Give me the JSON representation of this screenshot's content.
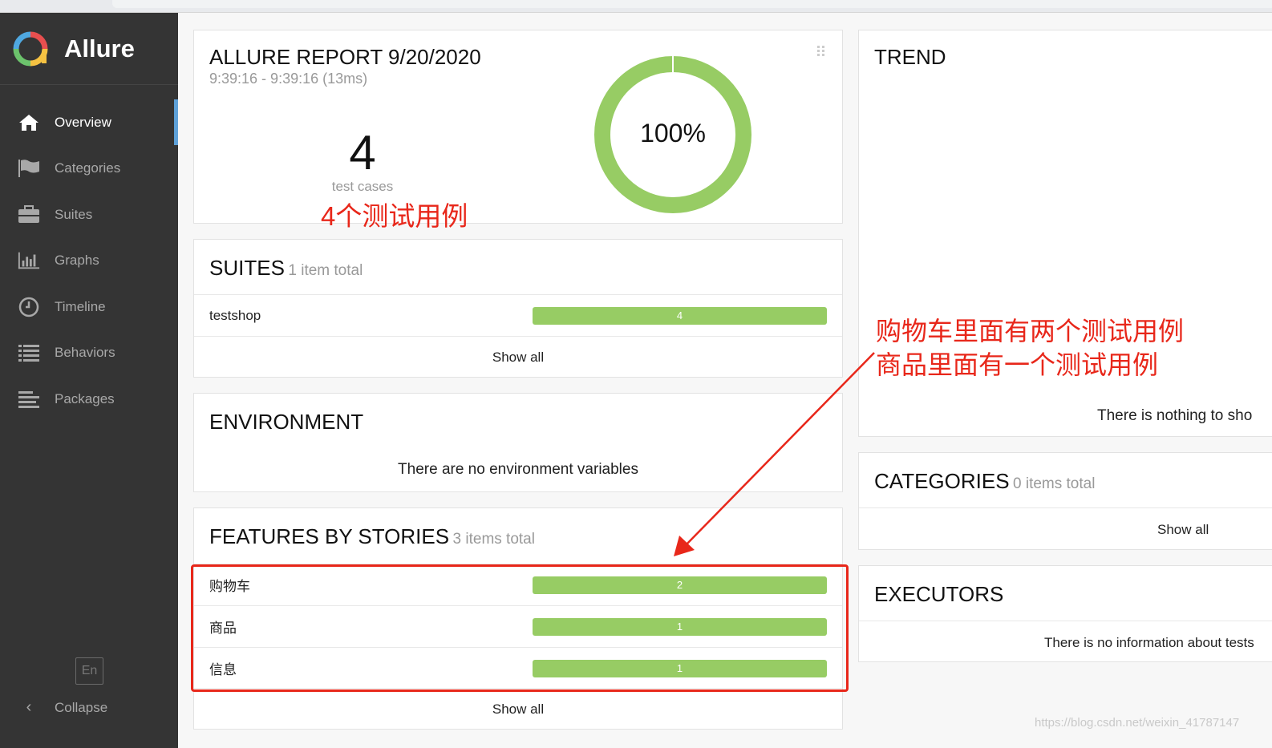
{
  "brand": {
    "name": "Allure"
  },
  "sidebar": {
    "items": [
      {
        "label": "Overview",
        "icon": "home-icon",
        "active": true
      },
      {
        "label": "Categories",
        "icon": "flag-icon"
      },
      {
        "label": "Suites",
        "icon": "briefcase-icon"
      },
      {
        "label": "Graphs",
        "icon": "bar-chart-icon"
      },
      {
        "label": "Timeline",
        "icon": "clock-icon"
      },
      {
        "label": "Behaviors",
        "icon": "list-icon"
      },
      {
        "label": "Packages",
        "icon": "align-left-icon"
      }
    ],
    "language": "En",
    "collapse_label": "Collapse"
  },
  "summary": {
    "title": "ALLURE REPORT 9/20/2020",
    "time": "9:39:16 - 9:39:16 (13ms)",
    "count": "4",
    "count_label": "test cases",
    "success_rate": "100%",
    "success_fraction": 1.0,
    "annotation": "4个测试用例"
  },
  "suites": {
    "title": "SUITES",
    "subtitle": "1 item total",
    "rows": [
      {
        "name": "testshop",
        "value": "4"
      }
    ],
    "show_all": "Show all"
  },
  "environment": {
    "title": "ENVIRONMENT",
    "empty_text": "There are no environment variables"
  },
  "features": {
    "title": "FEATURES BY STORIES",
    "subtitle": "3 items total",
    "rows": [
      {
        "name": "购物车",
        "value": "2"
      },
      {
        "name": "商品",
        "value": "1"
      },
      {
        "name": "信息",
        "value": "1"
      }
    ],
    "show_all": "Show all"
  },
  "trend": {
    "title": "TREND",
    "empty_text": "There is nothing to sho"
  },
  "categories": {
    "title": "CATEGORIES",
    "subtitle": "0 items total",
    "show_all": "Show all"
  },
  "executors": {
    "title": "EXECUTORS",
    "empty_text": "There is no information about tests"
  },
  "annotations": {
    "line1": "购物车里面有两个测试用例",
    "line2": "商品里面有一个测试用例"
  },
  "watermark": "https://blog.csdn.net/weixin_41787147",
  "colors": {
    "passed": "#97cc64",
    "sidebar": "#343434",
    "annotation": "#e8271a",
    "active_marker": "#5ea1d9"
  }
}
